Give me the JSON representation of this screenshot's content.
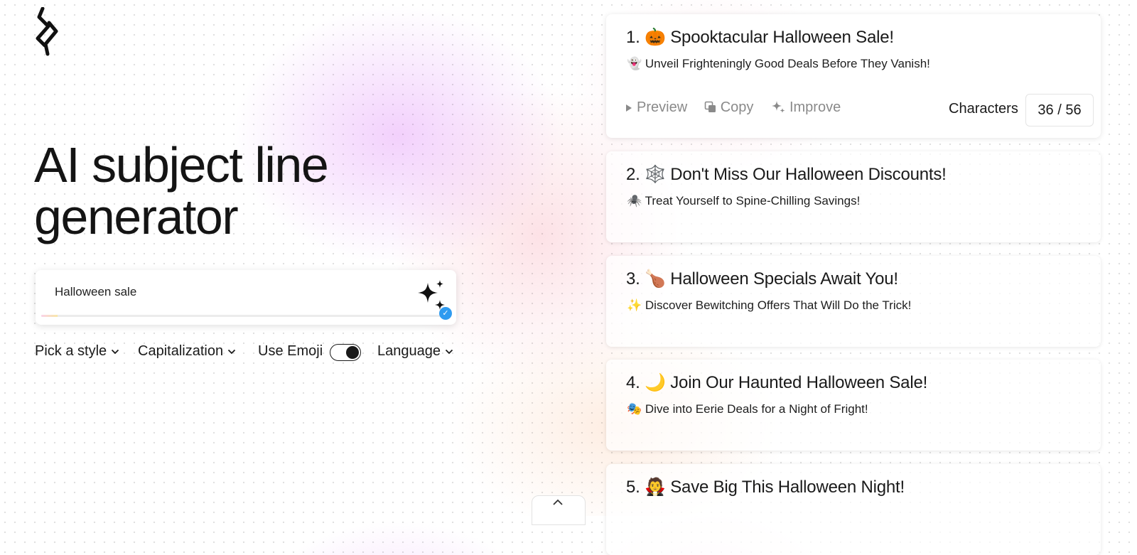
{
  "hero": {
    "title_line1": "AI subject line",
    "title_line2": "generator"
  },
  "input": {
    "value": "Halloween sale",
    "progress_fraction": 0.04
  },
  "controls": {
    "style_label": "Pick a style",
    "capitalization_label": "Capitalization",
    "emoji_label": "Use Emoji",
    "emoji_enabled": true,
    "language_label": "Language"
  },
  "results": [
    {
      "number": "1.",
      "emoji": "🎃",
      "title": "Spooktacular Halloween Sale!",
      "sub_emoji": "👻",
      "subtitle": "Unveil Frighteningly Good Deals Before They Vanish!"
    },
    {
      "number": "2.",
      "emoji": "🕸️",
      "title": "Don't Miss Our Halloween Discounts!",
      "sub_emoji": "🕷️",
      "subtitle": "Treat Yourself to Spine-Chilling Savings!"
    },
    {
      "number": "3.",
      "emoji": "🍗",
      "title": "Halloween Specials Await You!",
      "sub_emoji": "✨",
      "subtitle": "Discover Bewitching Offers That Will Do the Trick!"
    },
    {
      "number": "4.",
      "emoji": "🌙",
      "title": "Join Our Haunted Halloween Sale!",
      "sub_emoji": "🎭",
      "subtitle": "Dive into Eerie Deals for a Night of Fright!"
    },
    {
      "number": "5.",
      "emoji": "🧛",
      "title": "Save Big This Halloween Night!",
      "sub_emoji": "",
      "subtitle": ""
    }
  ],
  "actions": {
    "preview": "Preview",
    "copy": "Copy",
    "improve": "Improve"
  },
  "characters": {
    "label": "Characters",
    "count": "36 / 56"
  }
}
